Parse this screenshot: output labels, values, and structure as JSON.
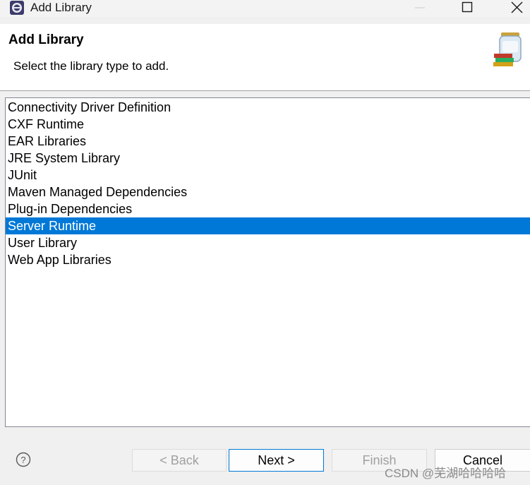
{
  "window": {
    "title": "Add Library"
  },
  "banner": {
    "title": "Add Library",
    "description": "Select the library type to add."
  },
  "library_types": [
    {
      "label": "Connectivity Driver Definition",
      "selected": false
    },
    {
      "label": "CXF Runtime",
      "selected": false
    },
    {
      "label": "EAR Libraries",
      "selected": false
    },
    {
      "label": "JRE System Library",
      "selected": false
    },
    {
      "label": "JUnit",
      "selected": false
    },
    {
      "label": "Maven Managed Dependencies",
      "selected": false
    },
    {
      "label": "Plug-in Dependencies",
      "selected": false
    },
    {
      "label": "Server Runtime",
      "selected": true
    },
    {
      "label": "User Library",
      "selected": false
    },
    {
      "label": "Web App Libraries",
      "selected": false
    }
  ],
  "buttons": {
    "back": {
      "label": "< Back",
      "enabled": false
    },
    "next": {
      "label": "Next >",
      "enabled": true
    },
    "finish": {
      "label": "Finish",
      "enabled": false
    },
    "cancel": {
      "label": "Cancel",
      "enabled": true
    }
  },
  "help_icon": "question-mark",
  "watermark": "CSDN @芜湖哈哈哈哈",
  "colors": {
    "selection": "#0078d7",
    "background": "#f0f0f0"
  }
}
